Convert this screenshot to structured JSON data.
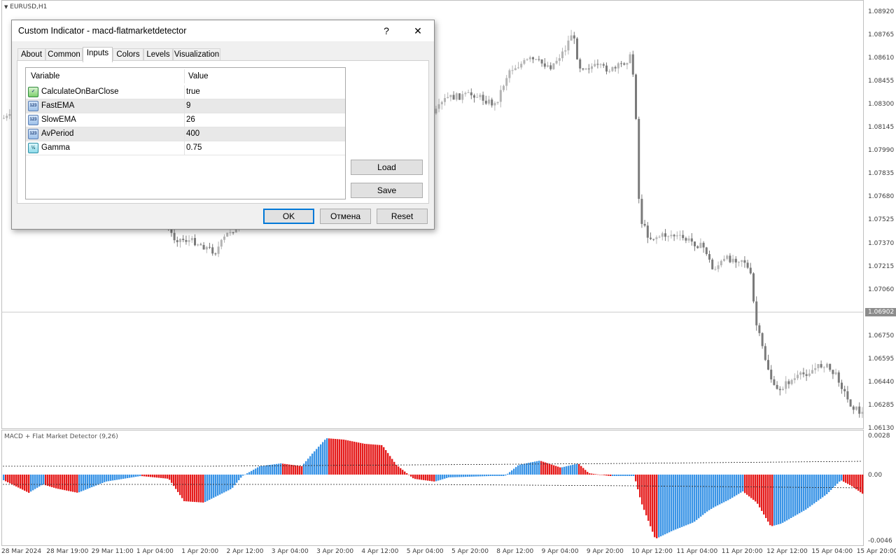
{
  "chart": {
    "symbol": "EURUSD,H1",
    "current_price": "1.06902",
    "price_axis": [
      "1.08920",
      "1.08765",
      "1.08610",
      "1.08455",
      "1.08300",
      "1.08145",
      "1.07990",
      "1.07835",
      "1.07680",
      "1.07525",
      "1.07370",
      "1.07215",
      "1.07060",
      "1.06750",
      "1.06595",
      "1.06440",
      "1.06285",
      "1.06130"
    ],
    "time_axis": [
      "28 Mar 2024",
      "28 Mar 19:00",
      "29 Mar 11:00",
      "1 Apr 04:00",
      "1 Apr 20:00",
      "2 Apr 12:00",
      "3 Apr 04:00",
      "3 Apr 20:00",
      "4 Apr 12:00",
      "5 Apr 04:00",
      "5 Apr 20:00",
      "8 Apr 12:00",
      "9 Apr 04:00",
      "9 Apr 20:00",
      "10 Apr 12:00",
      "11 Apr 04:00",
      "11 Apr 20:00",
      "12 Apr 12:00",
      "15 Apr 04:00",
      "15 Apr 20:00"
    ],
    "up_color": "#b4b4b4",
    "down_color": "#7a7a7a"
  },
  "indicator": {
    "label": "MACD + Flat Market Detector (9,26)",
    "axis": [
      "0.0028",
      "0.00",
      "-0.0046"
    ],
    "rising_color": "#3a94e6",
    "falling_color": "#e51b1b"
  },
  "dialog": {
    "title": "Custom Indicator - macd-flatmarketdetector",
    "help_icon": "?",
    "close_icon": "✕",
    "tabs": [
      "About",
      "Common",
      "Inputs",
      "Colors",
      "Levels",
      "Visualization"
    ],
    "active_tab": "Inputs",
    "grid": {
      "col_variable": "Variable",
      "col_value": "Value",
      "rows": [
        {
          "icon": "bool-param-icon",
          "name": "CalculateOnBarClose",
          "value": "true"
        },
        {
          "icon": "int-param-icon",
          "name": "FastEMA",
          "value": "9"
        },
        {
          "icon": "int-param-icon",
          "name": "SlowEMA",
          "value": "26"
        },
        {
          "icon": "int-param-icon",
          "name": "AvPeriod",
          "value": "400"
        },
        {
          "icon": "double-param-icon",
          "name": "Gamma",
          "value": "0.75"
        }
      ]
    },
    "load_label": "Load",
    "save_label": "Save",
    "ok_label": "OK",
    "cancel_label": "Отмена",
    "reset_label": "Reset"
  }
}
